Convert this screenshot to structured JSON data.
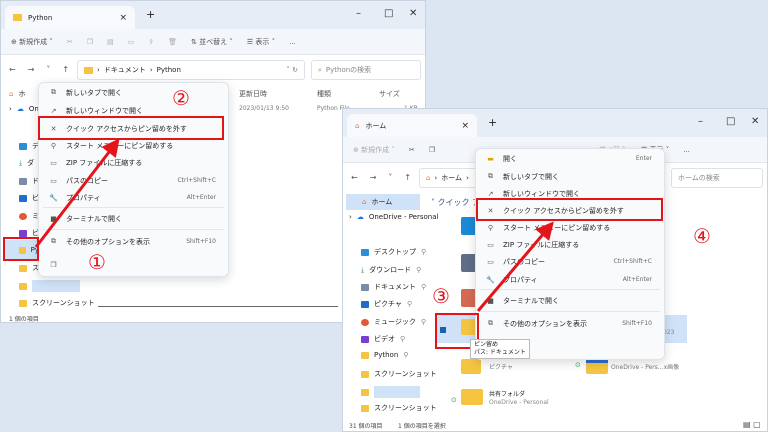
{
  "left_window": {
    "tab_title": "Python",
    "toolbar": {
      "new": "新規作成",
      "sort": "並べ替え",
      "view": "表示",
      "more": "..."
    },
    "breadcrumb": [
      "ドキュメント",
      "Python"
    ],
    "search_placeholder": "Pythonの検索",
    "columns": [
      "更新日時",
      "種類",
      "サイズ"
    ],
    "row": {
      "date": "2023/01/13 9:50",
      "type": "Python File",
      "size": "1 KB"
    },
    "nav": [
      "ホ",
      "On",
      "デ",
      "ダ",
      "ド",
      "ピ",
      "ミ",
      "ビ",
      "Py",
      "ス",
      "",
      "スクリーンショット"
    ],
    "status": "1 個の項目",
    "context_menu": [
      {
        "label": "新しいタブで開く",
        "shortcut": ""
      },
      {
        "label": "新しいウィンドウで開く",
        "shortcut": ""
      },
      {
        "label": "クイック アクセスからピン留めを外す",
        "shortcut": ""
      },
      {
        "label": "スタート メニューにピン留めする",
        "shortcut": ""
      },
      {
        "label": "ZIP ファイルに圧縮する",
        "shortcut": ""
      },
      {
        "label": "パスのコピー",
        "shortcut": "Ctrl+Shift+C"
      },
      {
        "label": "プロパティ",
        "shortcut": "Alt+Enter"
      },
      {
        "label": "ターミナルで開く",
        "shortcut": ""
      },
      {
        "label": "その他のオプションを表示",
        "shortcut": "Shift+F10"
      }
    ]
  },
  "right_window": {
    "tab_title": "ホーム",
    "toolbar": {
      "new": "新規作成",
      "sort": "並べ替え",
      "view": "表示",
      "more": "..."
    },
    "breadcrumb": [
      "ホーム"
    ],
    "search_placeholder": "ホームの検索",
    "section": "クイック アクセス",
    "nav": [
      "ホーム",
      "OneDrive - Personal",
      "デスクトップ",
      "ダウンロード",
      "ドキュメント",
      "ピクチャ",
      "ミュージック",
      "ビデオ",
      "Python",
      "スクリーンショット",
      "",
      "スクリーンショット"
    ],
    "items": [
      {
        "name": "ピクチャ",
        "sub": ""
      },
      {
        "name": "OneDrive - Pers...x画像",
        "sub": ""
      },
      {
        "name": "共有フォルダ",
        "sub": "OneDrive - Personal"
      }
    ],
    "tooltip": [
      "ピン留め",
      "パス: ドキュメント"
    ],
    "date_fragment": "023",
    "status": [
      "31 個の項目",
      "1 個の項目を選択"
    ],
    "context_menu": [
      {
        "label": "開く",
        "shortcut": "Enter"
      },
      {
        "label": "新しいタブで開く",
        "shortcut": ""
      },
      {
        "label": "新しいウィンドウで開く",
        "shortcut": ""
      },
      {
        "label": "クイック アクセスからピン留めを外す",
        "shortcut": ""
      },
      {
        "label": "スタート メニューにピン留めする",
        "shortcut": ""
      },
      {
        "label": "ZIP ファイルに圧縮する",
        "shortcut": ""
      },
      {
        "label": "パスのコピー",
        "shortcut": "Ctrl+Shift+C"
      },
      {
        "label": "プロパティ",
        "shortcut": "Alt+Enter"
      },
      {
        "label": "ターミナルで開く",
        "shortcut": ""
      },
      {
        "label": "その他のオプションを表示",
        "shortcut": "Shift+F10"
      }
    ]
  },
  "annotations": [
    "①",
    "②",
    "③",
    "④"
  ],
  "colors": {
    "annotation_red": "#e4141b",
    "selection": "#cfe2f7"
  }
}
